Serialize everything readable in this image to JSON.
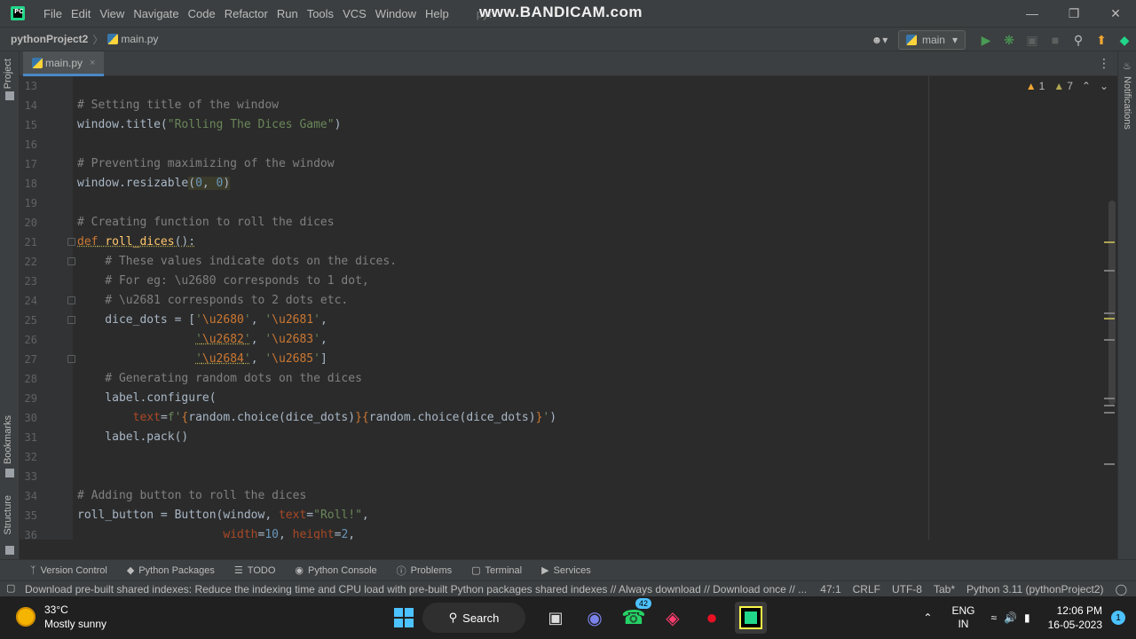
{
  "menubar": {
    "items": [
      "File",
      "Edit",
      "View",
      "Navigate",
      "Code",
      "Refactor",
      "Run",
      "Tools",
      "VCS",
      "Window",
      "Help"
    ],
    "project_hint": "pyt",
    "watermark": "www.BANDICAM.com",
    "logo_text": "PC"
  },
  "navbar": {
    "project": "pythonProject2",
    "file": "main.py",
    "branch": "main"
  },
  "left_strip": {
    "project": "Project",
    "bookmarks": "Bookmarks",
    "structure": "Structure"
  },
  "right_strip": {
    "notifications": "Notifications"
  },
  "tab": {
    "label": "main.py",
    "close": "×"
  },
  "inspections": {
    "warnings": "1",
    "weak_warnings": "7"
  },
  "editor": {
    "lines": [
      {
        "num": "13",
        "text": ""
      },
      {
        "num": "14",
        "text": "# Setting title of the window"
      },
      {
        "num": "15",
        "text": "window.title(\"Rolling The Dices Game\")"
      },
      {
        "num": "16",
        "text": ""
      },
      {
        "num": "17",
        "text": "# Preventing maximizing of the window"
      },
      {
        "num": "18",
        "text": "window.resizable(0, 0)"
      },
      {
        "num": "19",
        "text": ""
      },
      {
        "num": "20",
        "text": "# Creating function to roll the dices"
      },
      {
        "num": "21",
        "text": "def roll_dices():"
      },
      {
        "num": "22",
        "text": "    # These values indicate dots on the dices."
      },
      {
        "num": "23",
        "text": "    # For eg: \\u2680 corresponds to 1 dot,"
      },
      {
        "num": "24",
        "text": "    # \\u2681 corresponds to 2 dots etc."
      },
      {
        "num": "25",
        "text": "    dice_dots = ['\\u2680', '\\u2681',"
      },
      {
        "num": "26",
        "text": "                 '\\u2682', '\\u2683',"
      },
      {
        "num": "27",
        "text": "                 '\\u2684', '\\u2685']"
      },
      {
        "num": "28",
        "text": "    # Generating random dots on the dices"
      },
      {
        "num": "29",
        "text": "    label.configure("
      },
      {
        "num": "30",
        "text": "        text=f'{random.choice(dice_dots)}{random.choice(dice_dots)}')"
      },
      {
        "num": "31",
        "text": "    label.pack()"
      },
      {
        "num": "32",
        "text": ""
      },
      {
        "num": "33",
        "text": ""
      },
      {
        "num": "34",
        "text": "# Adding button to roll the dices"
      },
      {
        "num": "35",
        "text": "roll_button = Button(window, text=\"Roll!\","
      },
      {
        "num": "36",
        "text": "                     width=10, height=2,"
      }
    ]
  },
  "toolwindows": [
    "Version Control",
    "Python Packages",
    "TODO",
    "Python Console",
    "Problems",
    "Terminal",
    "Services"
  ],
  "statusbar": {
    "message": "Download pre-built shared indexes: Reduce the indexing time and CPU load with pre-built Python packages shared indexes // Always download // Download once // ...",
    "position": "47:1",
    "line_sep": "CRLF",
    "encoding": "UTF-8",
    "indent": "Tab*",
    "interpreter": "Python 3.11 (pythonProject2)"
  },
  "taskbar": {
    "temperature": "33°C",
    "weather": "Mostly sunny",
    "search": "Search",
    "whatsapp_badge": "42",
    "lang1": "ENG",
    "lang2": "IN",
    "time": "12:06 PM",
    "date": "16-05-2023",
    "notifications": "1"
  }
}
